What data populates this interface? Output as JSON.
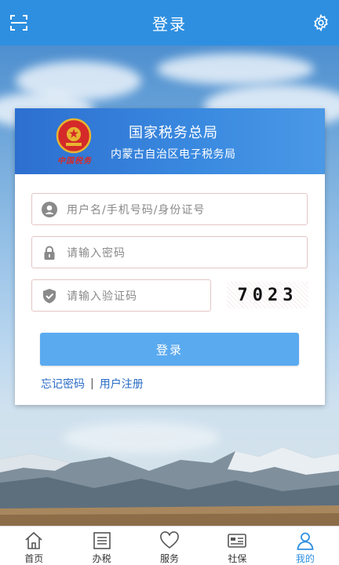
{
  "header": {
    "title": "登录",
    "left_icon": "scan-icon",
    "right_icon": "gear-icon"
  },
  "card": {
    "org_name": "国家税务总局",
    "sub_org": "内蒙古自治区电子税务局",
    "emblem_caption": "中国税务"
  },
  "form": {
    "username_placeholder": "用户名/手机号码/身份证号",
    "password_placeholder": "请输入密码",
    "captcha_placeholder": "请输入验证码",
    "captcha_code": "7023",
    "login_label": "登录",
    "forgot_label": "忘记密码",
    "separator": "|",
    "register_label": "用户注册"
  },
  "tabs": [
    {
      "label": "首页",
      "icon": "home-icon",
      "active": false
    },
    {
      "label": "办税",
      "icon": "list-icon",
      "active": false
    },
    {
      "label": "服务",
      "icon": "heart-icon",
      "active": false
    },
    {
      "label": "社保",
      "icon": "id-card-icon",
      "active": false
    },
    {
      "label": "我的",
      "icon": "person-icon",
      "active": true
    }
  ],
  "colors": {
    "header": "#2e8fe0",
    "card_header": "#3a8ae0",
    "button": "#5aaaf0",
    "link": "#2a6cc4",
    "active_tab": "#2e8fe0"
  }
}
